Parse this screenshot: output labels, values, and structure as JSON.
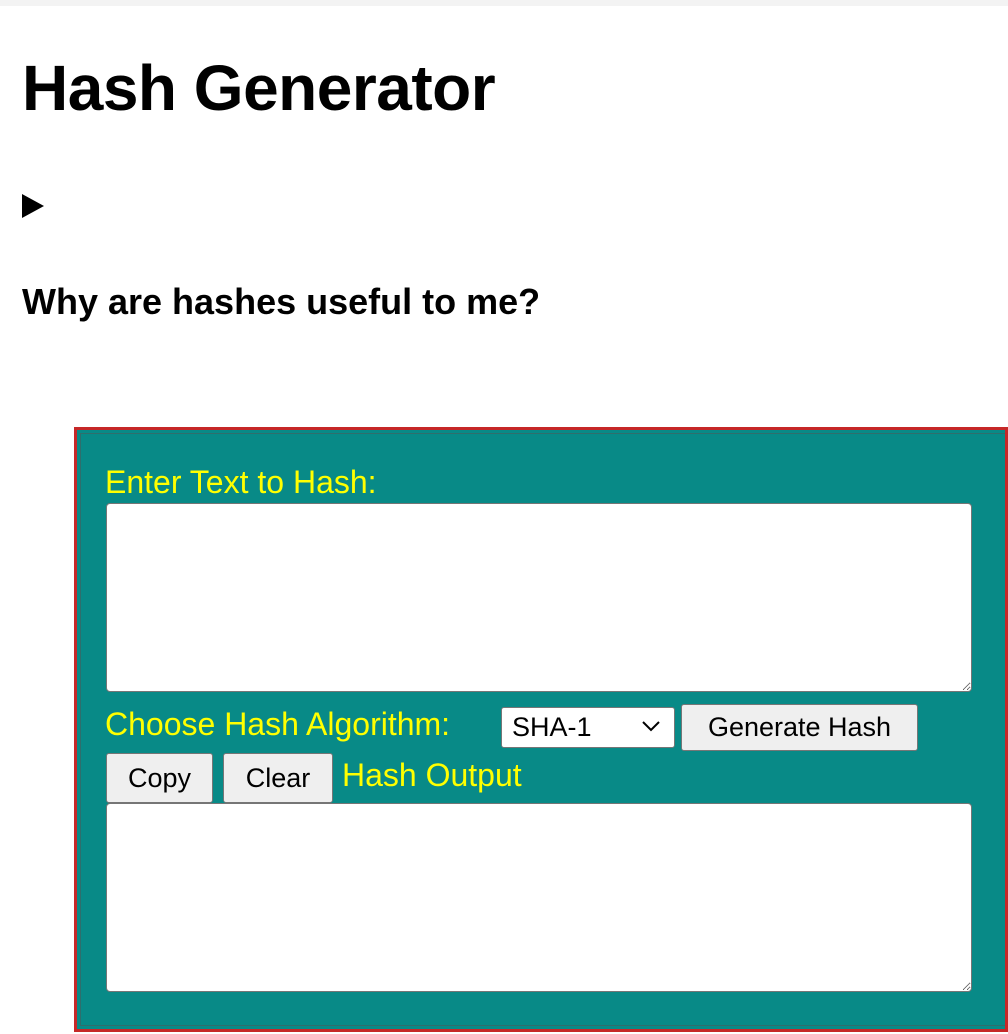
{
  "page": {
    "title": "Hash Generator",
    "faq_heading": "Why are hashes useful to me?",
    "disclosure_icon": "triangle-right-icon"
  },
  "form": {
    "input_label": "Enter Text to Hash:",
    "input_value": "",
    "algorithm_label": "Choose Hash Algorithm:",
    "algorithm_selected": "SHA-1",
    "generate_label": "Generate Hash",
    "copy_label": "Copy",
    "clear_label": "Clear",
    "output_label": "Hash Output",
    "output_value": ""
  },
  "colors": {
    "panel_background": "#088a87",
    "panel_border": "#c62828",
    "label_text": "#ffff00"
  }
}
